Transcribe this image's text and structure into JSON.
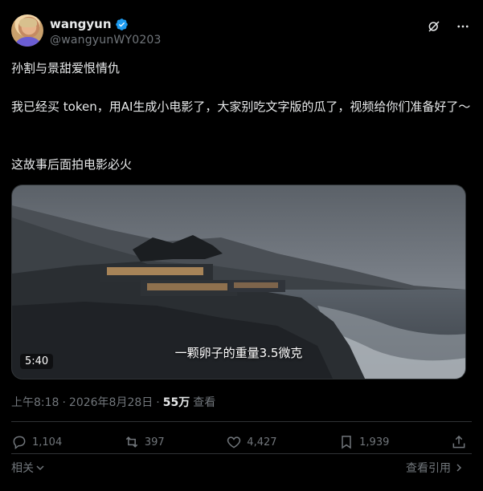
{
  "author": {
    "display_name": "wangyun",
    "handle": "@wangyunWY0203",
    "verified": true,
    "verified_color": "#1d9bf0"
  },
  "tweet": {
    "line1": "孙割与景甜爱恨情仇",
    "line2": "我已经买 token，用AI生成小电影了，大家别吃文字版的瓜了，视频给你们准备好了～",
    "line3": "这故事后面拍电影必火"
  },
  "media": {
    "type": "video",
    "duration": "5:40",
    "caption": "一颗卵子的重量3.5微克"
  },
  "meta": {
    "time": "上午8:18",
    "separator": "·",
    "date": "2026年8月28日",
    "views_count": "55万",
    "views_label": "查看"
  },
  "actions": {
    "replies": "1,104",
    "reposts": "397",
    "likes": "4,427",
    "bookmarks": "1,939"
  },
  "footer": {
    "related_label": "相关",
    "view_quotes_label": "查看引用"
  },
  "icons": {
    "grok": "grok-icon",
    "more": "more-icon",
    "reply": "reply-icon",
    "repost": "repost-icon",
    "like": "like-icon",
    "bookmark": "bookmark-icon",
    "share": "share-icon"
  }
}
